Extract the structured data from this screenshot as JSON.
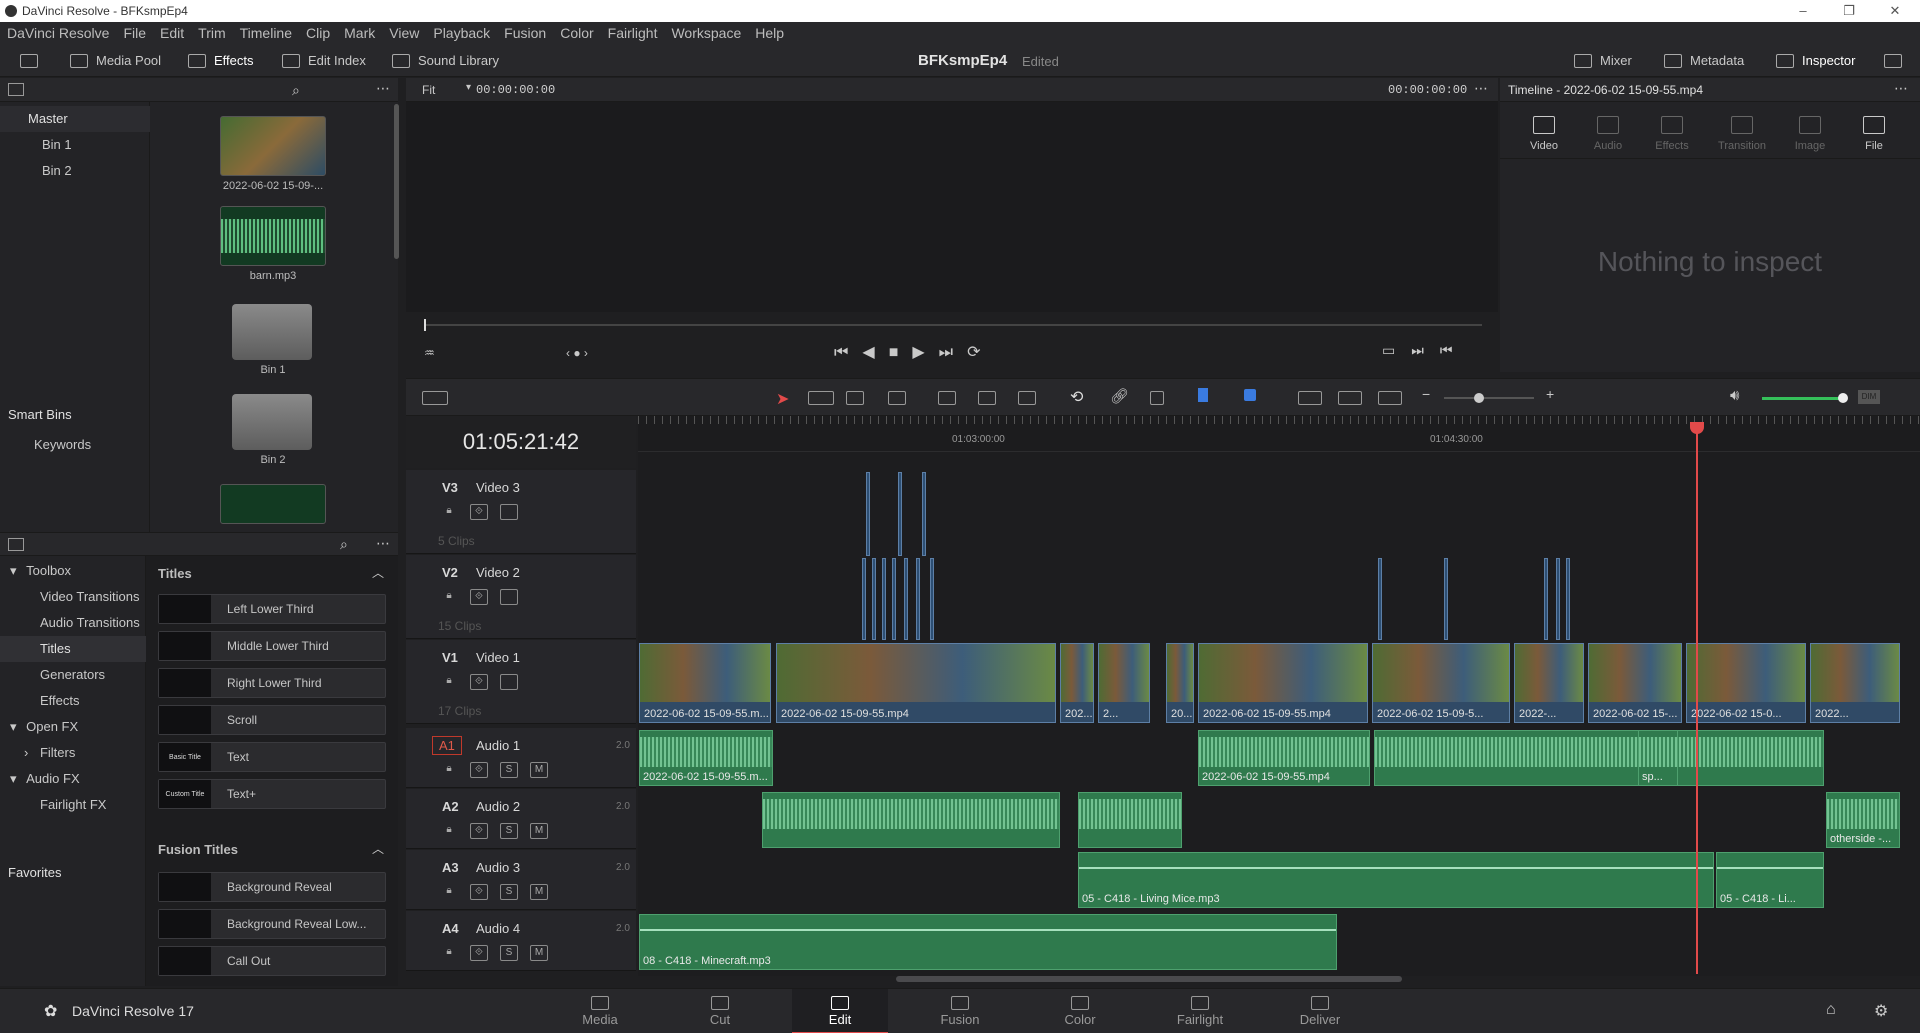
{
  "window": {
    "title": "DaVinci Resolve - BFKsmpEp4"
  },
  "menu": [
    "DaVinci Resolve",
    "File",
    "Edit",
    "Trim",
    "Timeline",
    "Clip",
    "Mark",
    "View",
    "Playback",
    "Fusion",
    "Color",
    "Fairlight",
    "Workspace",
    "Help"
  ],
  "toolbar": {
    "media_pool": "Media Pool",
    "effects": "Effects",
    "edit_index": "Edit Index",
    "sound_library": "Sound Library",
    "project": "BFKsmpEp4",
    "status": "Edited",
    "mixer": "Mixer",
    "metadata": "Metadata",
    "inspector": "Inspector"
  },
  "media_pool": {
    "bins": [
      "Master",
      "Bin 1",
      "Bin 2"
    ],
    "smart_bins": "Smart Bins",
    "keywords": "Keywords",
    "clips": [
      "2022-06-02 15-09-...",
      "barn.mp3",
      "Bin 1",
      "Bin 2"
    ]
  },
  "effects": {
    "tree": [
      "Toolbox",
      "Video Transitions",
      "Audio Transitions",
      "Titles",
      "Generators",
      "Effects",
      "Open FX",
      "Filters",
      "Audio FX",
      "Fairlight FX"
    ],
    "favorites": "Favorites",
    "titles_header": "Titles",
    "titles": [
      "Left Lower Third",
      "Middle Lower Third",
      "Right Lower Third",
      "Scroll",
      "Text",
      "Text+"
    ],
    "title_thumbs": [
      "",
      "",
      "",
      "",
      "Basic Title",
      "Custom Title"
    ],
    "fusion_header": "Fusion Titles",
    "fusion_titles": [
      "Background Reveal",
      "Background Reveal Low...",
      "Call Out"
    ]
  },
  "viewer": {
    "zoom": "Fit",
    "timecode_left": "00:00:00:00",
    "timecode_right": "00:00:00:00"
  },
  "inspector": {
    "title": "Timeline - 2022-06-02 15-09-55.mp4",
    "tabs": [
      "Video",
      "Audio",
      "Effects",
      "Transition",
      "Image",
      "File"
    ],
    "empty": "Nothing to inspect"
  },
  "timeline": {
    "timecode": "01:05:21:42",
    "ruler": [
      "01:03:00:00",
      "01:04:30:00"
    ],
    "tracks": [
      {
        "id": "V3",
        "name": "Video 3",
        "count": "5 Clips"
      },
      {
        "id": "V2",
        "name": "Video 2",
        "count": "15 Clips"
      },
      {
        "id": "V1",
        "name": "Video 1",
        "count": "17 Clips"
      },
      {
        "id": "A1",
        "name": "Audio 1",
        "ch": "2.0"
      },
      {
        "id": "A2",
        "name": "Audio 2",
        "ch": "2.0"
      },
      {
        "id": "A3",
        "name": "Audio 3",
        "ch": "2.0"
      },
      {
        "id": "A4",
        "name": "Audio 4",
        "ch": "2.0"
      }
    ],
    "v1_clips": [
      "2022-06-02 15-09-55.m...",
      "2022-06-02 15-09-55.mp4",
      "202...",
      "2...",
      "20...",
      "2022-06-02 15-09-55.mp4",
      "2022-06-02 15-09-5...",
      "2022-...",
      "2022-06-02 15-...",
      "2022-06-02 15-0...",
      "2022..."
    ],
    "a1_clips": [
      "2022-06-02 15-09-55.m...",
      "2022-06-02 15-09-55.mp4",
      "sp..."
    ],
    "a2_clips": [
      "otherside -..."
    ],
    "a3_clips": [
      "05 - C418 - Living Mice.mp3",
      "05 - C418 - Li..."
    ],
    "a4_clips": [
      "08 - C418 - Minecraft.mp3"
    ],
    "solo": "S",
    "mute": "M"
  },
  "pages": [
    "Media",
    "Cut",
    "Edit",
    "Fusion",
    "Color",
    "Fairlight",
    "Deliver"
  ],
  "app_name": "DaVinci Resolve 17"
}
